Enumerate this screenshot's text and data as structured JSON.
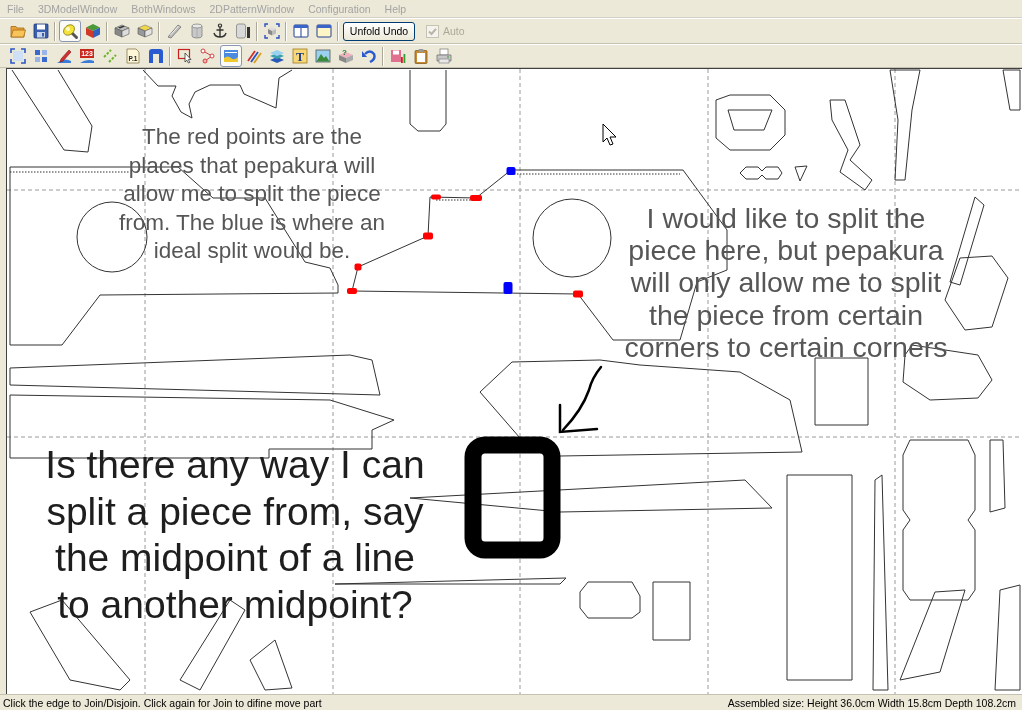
{
  "menu": [
    {
      "label": "File",
      "disabled": true
    },
    {
      "label": "3DModelWindow",
      "disabled": true
    },
    {
      "label": "BothWindows",
      "disabled": true
    },
    {
      "label": "2DPatternWindow",
      "disabled": true
    },
    {
      "label": "Configuration",
      "disabled": true
    },
    {
      "label": "Help",
      "disabled": true
    }
  ],
  "toolbars": [
    {
      "groups": [
        {
          "items": [
            {
              "kind": "folder",
              "selected": false
            },
            {
              "kind": "floppy",
              "selected": false
            }
          ]
        },
        {
          "items": [
            {
              "kind": "flashlight",
              "selected": true
            },
            {
              "kind": "cube",
              "selected": false
            }
          ]
        },
        {
          "items": [
            {
              "kind": "box",
              "selected": false
            },
            {
              "kind": "openbox",
              "selected": false
            }
          ]
        },
        {
          "items": [
            {
              "kind": "blade",
              "selected": false
            },
            {
              "kind": "cylinder",
              "selected": false
            },
            {
              "kind": "anchor",
              "selected": false
            },
            {
              "kind": "panel",
              "selected": false
            }
          ]
        },
        {
          "items": [
            {
              "kind": "cubeselect",
              "selected": false
            }
          ]
        },
        {
          "items": [
            {
              "kind": "splitwindow",
              "selected": false
            },
            {
              "kind": "window",
              "selected": false
            }
          ]
        },
        {
          "items": [
            {
              "kind": "button",
              "label": "Unfold Undo",
              "selected": false
            },
            {
              "kind": "checkbox",
              "label": "Auto",
              "checked": true,
              "disabled": true
            }
          ]
        }
      ]
    },
    {
      "groups": [
        {
          "items": [
            {
              "kind": "frame",
              "selected": false
            },
            {
              "kind": "tiles",
              "selected": false
            },
            {
              "kind": "pen",
              "selected": false
            },
            {
              "kind": "numbers",
              "label": "123",
              "selected": false
            },
            {
              "kind": "dashes",
              "selected": false
            },
            {
              "kind": "page",
              "label": "P.1",
              "selected": false
            },
            {
              "kind": "arch",
              "selected": false
            }
          ]
        },
        {
          "items": [
            {
              "kind": "select",
              "selected": false
            },
            {
              "kind": "nodes",
              "selected": false
            },
            {
              "kind": "texture",
              "selected": true
            },
            {
              "kind": "stripes",
              "selected": false
            },
            {
              "kind": "layers",
              "selected": false
            },
            {
              "kind": "texttool",
              "label": "T",
              "selected": false
            },
            {
              "kind": "picture",
              "selected": false
            },
            {
              "kind": "help",
              "label": "?",
              "selected": false
            },
            {
              "kind": "undo",
              "selected": false
            }
          ]
        },
        {
          "items": [
            {
              "kind": "savechart",
              "selected": false
            },
            {
              "kind": "clipboard",
              "selected": false
            },
            {
              "kind": "printer",
              "selected": false
            }
          ]
        }
      ]
    }
  ],
  "canvas": {
    "notes": [
      {
        "text": "The red points are the places that pepakura will allow me to split the piece from. The blue is where an ideal split would be."
      },
      {
        "text": "I would like to split the piece here, but pepakura will only allow me to split the piece from certain corners to certain corners"
      },
      {
        "text": "Is there any way I can split a piece from, say the midpoint of a line to another midpoint?"
      }
    ],
    "split_points": [
      {
        "color": "#0000ff"
      },
      {
        "color": "#ff0000"
      },
      {
        "color": "#ff0000"
      },
      {
        "color": "#ff0000"
      },
      {
        "color": "#ff0000"
      },
      {
        "color": "#0000ff"
      },
      {
        "color": "#ff0000"
      },
      {
        "color": "#ff0000"
      }
    ]
  },
  "status_bar": {
    "message": "Click the edge to Join/Disjoin. Click again for Join to difine move part",
    "size": "Assembled size: Height 36.0cm Width 15.8cm Depth 108.2cm"
  }
}
